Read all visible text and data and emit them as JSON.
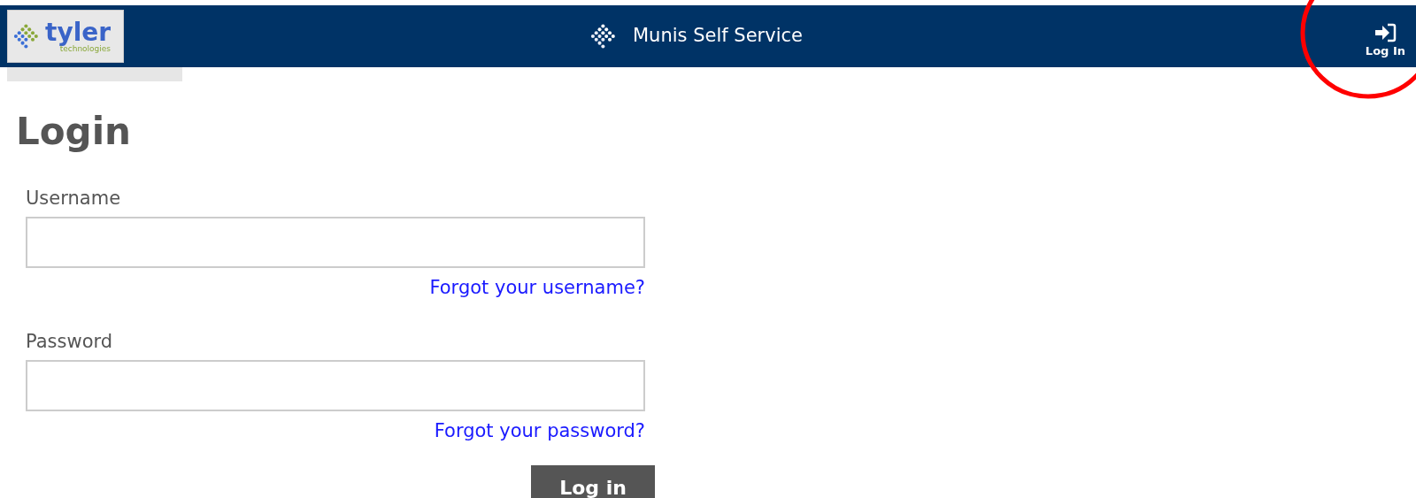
{
  "header": {
    "logo": {
      "name": "tyler",
      "tagline": "technologies"
    },
    "title": "Munis Self Service",
    "login_button": "Log In"
  },
  "page": {
    "heading": "Login",
    "fields": [
      {
        "label": "Username",
        "link": "Forgot your username?"
      },
      {
        "label": "Password",
        "link": "Forgot your password?"
      }
    ],
    "submit": "Log in"
  }
}
